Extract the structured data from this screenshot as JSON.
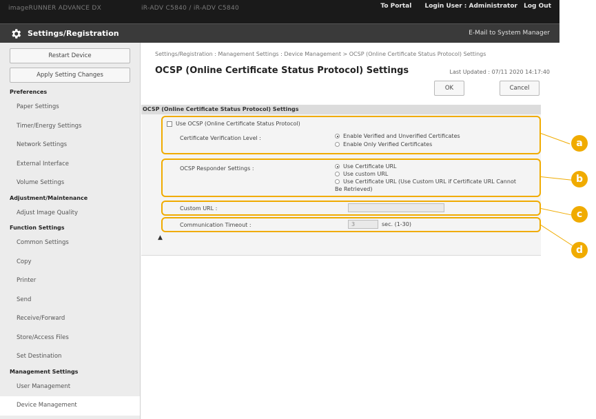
{
  "topbar": {
    "blur_left": "imageRUNNER ADVANCE DX",
    "blur_mid": "iR-ADV C5840 / iR-ADV C5840",
    "to_portal": "To Portal",
    "login_user": "Login User :  Administrator",
    "log_out": "Log Out"
  },
  "titlebar": {
    "title": "Settings/Registration",
    "email_link": "E-Mail to System Manager"
  },
  "sidebar": {
    "restart_device": "Restart Device",
    "apply_changes": "Apply Setting Changes",
    "sections": [
      {
        "title": "Preferences",
        "items": [
          "Paper Settings",
          "Timer/Energy Settings",
          "Network Settings",
          "External Interface",
          "Volume Settings"
        ]
      },
      {
        "title": "Adjustment/Maintenance",
        "items": [
          "Adjust Image Quality"
        ]
      },
      {
        "title": "Function Settings",
        "items": [
          "Common Settings",
          "Copy",
          "Printer",
          "Send",
          "Receive/Forward",
          "Store/Access Files",
          "Set Destination"
        ]
      },
      {
        "title": "Management Settings",
        "items": [
          "User Management",
          "Device Management"
        ]
      }
    ]
  },
  "main": {
    "breadcrumb": "Settings/Registration : Management Settings : Device Management > OCSP (Online Certificate Status Protocol) Settings",
    "page_title": "OCSP (Online Certificate Status Protocol) Settings",
    "last_updated": "Last Updated : 07/11 2020 14:17:40",
    "ok_label": "OK",
    "cancel_label": "Cancel",
    "section_header": "OCSP (Online Certificate Status Protocol) Settings",
    "use_ocsp_label": "Use OCSP (Online Certificate Status Protocol)",
    "cert_level_label": "Certificate Verification Level :",
    "cert_level_options": [
      "Enable Verified and Unverified Certificates",
      "Enable Only Verified Certificates"
    ],
    "cert_level_selected": 0,
    "responder_label": "OCSP Responder Settings :",
    "responder_options": [
      "Use Certificate URL",
      "Use custom URL",
      "Use Certificate URL (Use Custom URL if Certificate URL Cannot",
      "Be Retrieved)"
    ],
    "responder_selected": 0,
    "custom_url_label": "Custom URL :",
    "custom_url_value": "",
    "timeout_label": "Communication Timeout :",
    "timeout_value": "3",
    "timeout_unit": "sec. (1-30)",
    "to_top": "▲"
  },
  "callouts": [
    "a",
    "b",
    "c",
    "d"
  ],
  "colors": {
    "accent": "#f0ab00",
    "topbar": "#1a1a1a",
    "titlebar": "#3a3a3a"
  }
}
